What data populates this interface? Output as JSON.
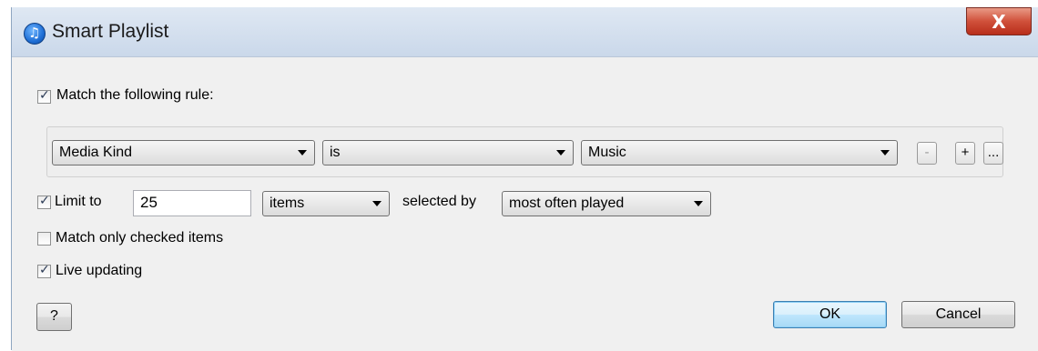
{
  "window": {
    "title": "Smart Playlist",
    "close_label": "X"
  },
  "match_rule": {
    "checked": true,
    "label": "Match the following rule:"
  },
  "rule": {
    "field": "Media Kind",
    "operator": "is",
    "value": "Music",
    "remove_label": "-",
    "add_label": "+",
    "more_label": "..."
  },
  "limit": {
    "checked": true,
    "label": "Limit to",
    "amount": "25",
    "unit": "items",
    "selected_by_label": "selected by",
    "selected_by": "most often played"
  },
  "match_checked": {
    "checked": false,
    "label": "Match only checked items"
  },
  "live_updating": {
    "checked": true,
    "label": "Live updating"
  },
  "buttons": {
    "help": "?",
    "ok": "OK",
    "cancel": "Cancel"
  }
}
